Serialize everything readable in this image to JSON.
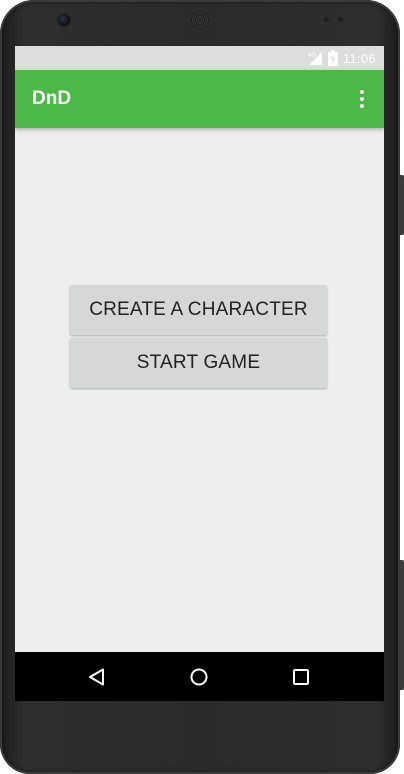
{
  "status_bar": {
    "time": "11:06",
    "icons": [
      "signal-4g-icon",
      "battery-charging-icon"
    ]
  },
  "app_bar": {
    "title": "DnD",
    "menu_icon": "overflow-menu-icon",
    "color": "#4cb848"
  },
  "main": {
    "buttons": [
      {
        "label": "CREATE A CHARACTER"
      },
      {
        "label": "START GAME"
      }
    ]
  },
  "nav_bar": {
    "icons": [
      "back-icon",
      "home-icon",
      "recents-icon"
    ]
  }
}
